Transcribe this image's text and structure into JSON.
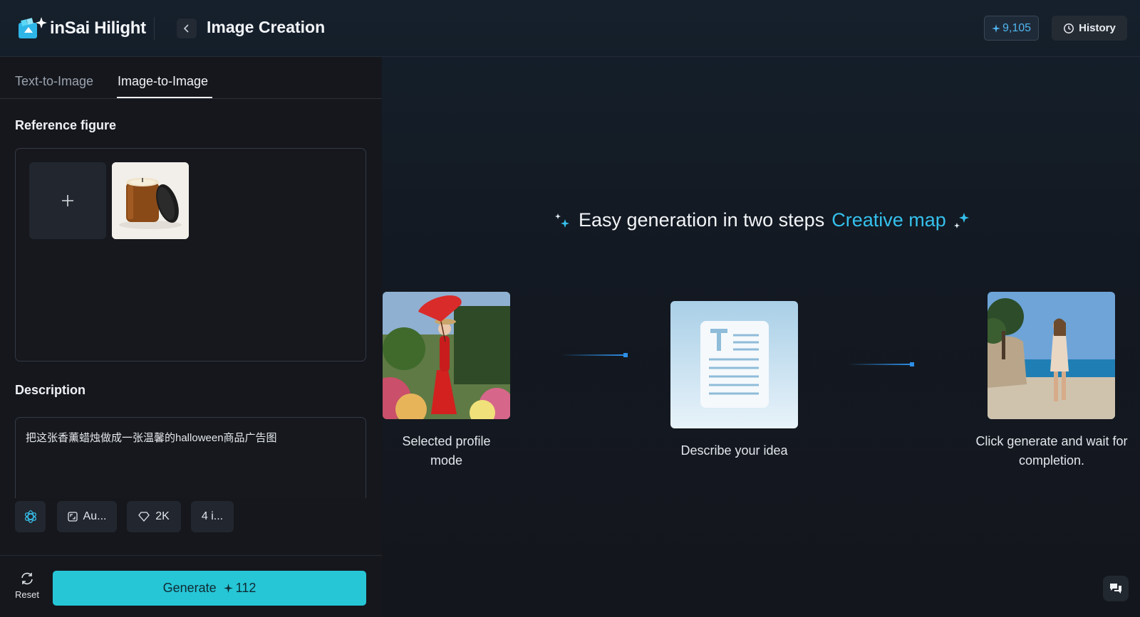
{
  "header": {
    "brand": "inSai Hilight",
    "back_icon": "chevron-left-icon",
    "title": "Image Creation",
    "credits": "9,105",
    "history_label": "History"
  },
  "tabs": [
    {
      "label": "Text-to-Image",
      "active": false
    },
    {
      "label": "Image-to-Image",
      "active": true
    }
  ],
  "reference": {
    "label": "Reference figure",
    "add_icon": "plus-icon"
  },
  "description": {
    "label": "Description",
    "value": "把这张香薰蜡烛做成一张温馨的halloween商品广告图"
  },
  "options": {
    "model_icon": "openai-icon",
    "aspect": "Au...",
    "quality": "2K",
    "count": "4 i..."
  },
  "actions": {
    "reset_label": "Reset",
    "generate_label": "Generate",
    "generate_cost": "112"
  },
  "intro": {
    "title_main": "Easy generation in two steps",
    "title_accent": "Creative map",
    "steps": [
      {
        "label_line1": "Selected profile",
        "label_line2": "mode"
      },
      {
        "label_line1": "Describe your idea",
        "label_line2": ""
      },
      {
        "label_line1": "Click generate and wait for",
        "label_line2": "completion."
      }
    ]
  },
  "colors": {
    "accent": "#26c6d6",
    "link_blue": "#35c0ec",
    "credits_blue": "#4fb6f0"
  }
}
